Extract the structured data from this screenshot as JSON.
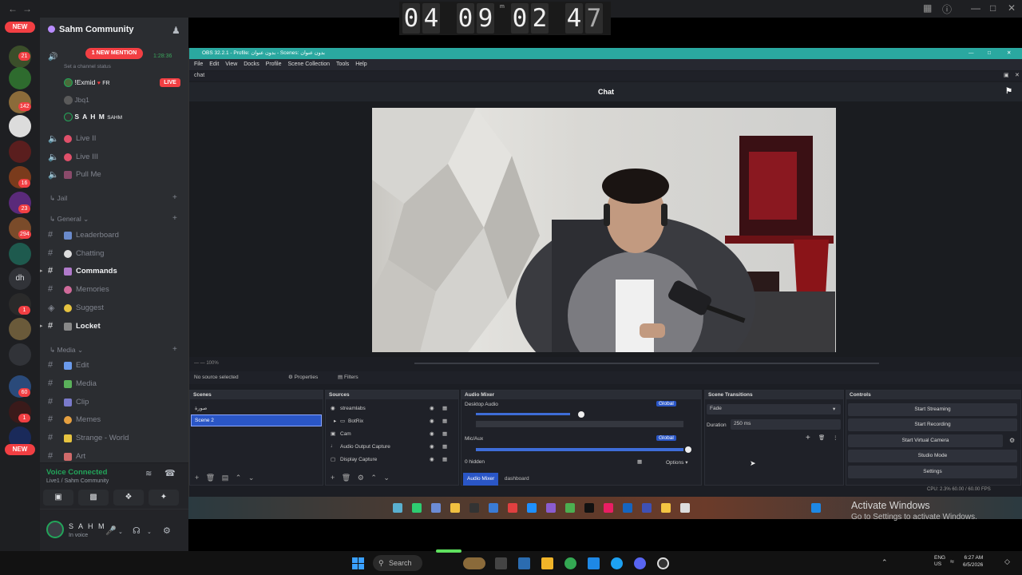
{
  "discord": {
    "new_badge": "NEW",
    "server_badges": [
      "21",
      "142",
      "16",
      "23",
      "294",
      "1",
      "60",
      "1"
    ],
    "server_text": "dh",
    "guild_name": "Sahm Community",
    "mention_pill": "1 NEW MENTION",
    "voice_timer": "1:28:36",
    "voice_status_hint": "Set a channel status",
    "voice_users": [
      {
        "name": "!Exmid",
        "tag": "FR"
      },
      {
        "name": "Jbq1",
        "tag": ""
      },
      {
        "name": "S A H M",
        "tag": "SAHM"
      }
    ],
    "live_badge": "LIVE",
    "channels_top": [
      {
        "label": "Live II"
      },
      {
        "label": "Live III"
      },
      {
        "label": "Pull Me"
      }
    ],
    "categories": {
      "jail": "Jail",
      "general": "General",
      "media": "Media"
    },
    "general_channels": [
      {
        "label": "Leaderboard"
      },
      {
        "label": "Chatting"
      },
      {
        "label": "Commands"
      },
      {
        "label": "Memories"
      },
      {
        "label": "Suggest"
      },
      {
        "label": "Locket"
      }
    ],
    "media_channels": [
      {
        "label": "Edit"
      },
      {
        "label": "Media"
      },
      {
        "label": "Clip"
      },
      {
        "label": "Memes"
      },
      {
        "label": "Strange - World"
      },
      {
        "label": "Art"
      }
    ],
    "voice_connected": "Voice Connected",
    "voice_location": "Live1 / Sahm Community",
    "user_name": "S A H M",
    "user_status": "In voice"
  },
  "clock": {
    "digits": [
      "0",
      "4",
      "0",
      "9",
      "0",
      "2",
      "4",
      "7"
    ],
    "mark": "m"
  },
  "obs": {
    "title": "OBS 32.2.1 - Profile: بدون عنوان - Scenes: بدون عنوان",
    "menu": [
      "File",
      "Edit",
      "View",
      "Docks",
      "Profile",
      "Scene Collection",
      "Tools",
      "Help"
    ],
    "dock_tab": "chat",
    "chat_title": "Chat",
    "no_source": "No source selected",
    "properties": "Properties",
    "filters": "Filters",
    "scenes_title": "Scenes",
    "scenes": [
      "صورة",
      "Scene 2"
    ],
    "sources_title": "Sources",
    "sources": [
      "streamlabs",
      "BotRix",
      "Cam",
      "Audio Output Capture",
      "Display Capture"
    ],
    "mixer_title": "Audio Mixer",
    "mixer_tracks": [
      "Desktop Audio",
      "Mic/Aux"
    ],
    "global": "Global",
    "hidden_count": "0 hidden",
    "options": "Options",
    "tab_mixer": "Audio Mixer",
    "tab_dashboard": "dashboard",
    "transitions_title": "Scene Transitions",
    "transition": "Fade",
    "duration_label": "Duration",
    "duration_value": "250 ms",
    "controls_title": "Controls",
    "controls": [
      "Start Streaming",
      "Start Recording",
      "Start Virtual Camera",
      "Studio Mode",
      "Settings"
    ],
    "status": "CPU: 2.3%    60.00 / 60.00 FPS"
  },
  "watermark": {
    "title": "Activate Windows",
    "subtitle": "Go to Settings to activate Windows."
  },
  "taskbar": {
    "search": "Search",
    "lang": "ENG US",
    "time": "6:27 AM",
    "date": "6/5/2026"
  }
}
